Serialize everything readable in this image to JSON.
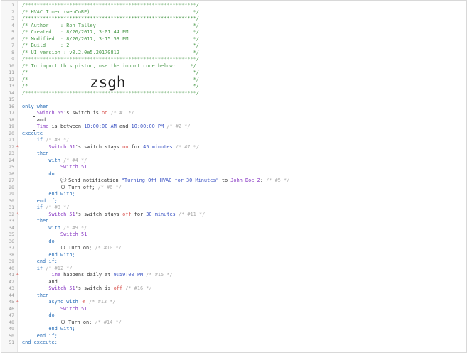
{
  "editor": {
    "lines": [
      {
        "n": "1",
        "parts": [
          {
            "t": "/**********************************************************/",
            "c": "c"
          }
        ]
      },
      {
        "n": "2",
        "parts": [
          {
            "t": "/* HVAC Timer (webCoRE)                                   */",
            "c": "c"
          }
        ]
      },
      {
        "n": "3",
        "parts": [
          {
            "t": "/**********************************************************/",
            "c": "c"
          }
        ]
      },
      {
        "n": "4",
        "parts": [
          {
            "t": "/* Author    : Ron Talley                                 */",
            "c": "c"
          }
        ]
      },
      {
        "n": "5",
        "parts": [
          {
            "t": "/* Created   : 8/26/2017, 3:01:44 PM                      */",
            "c": "c"
          }
        ]
      },
      {
        "n": "6",
        "parts": [
          {
            "t": "/* Modified  : 8/26/2017, 3:15:53 PM                      */",
            "c": "c"
          }
        ]
      },
      {
        "n": "7",
        "parts": [
          {
            "t": "/* Build     : 2                                          */",
            "c": "c"
          }
        ]
      },
      {
        "n": "8",
        "parts": [
          {
            "t": "/* UI version : v0.2.0e5.20170812                         */",
            "c": "c"
          }
        ]
      },
      {
        "n": "9",
        "parts": [
          {
            "t": "/**********************************************************/",
            "c": "c"
          }
        ]
      },
      {
        "n": "10",
        "parts": [
          {
            "t": "/* To import this piston, use the import code below:     */",
            "c": "c"
          }
        ]
      },
      {
        "n": "11",
        "parts": [
          {
            "t": "/*                                                        */",
            "c": "c"
          }
        ]
      },
      {
        "n": "12",
        "parts": [
          {
            "t": "/*                                                        */",
            "c": "c"
          }
        ]
      },
      {
        "n": "13",
        "parts": [
          {
            "t": "/*                                                        */",
            "c": "c"
          }
        ]
      },
      {
        "n": "14",
        "parts": [
          {
            "t": "/**********************************************************/",
            "c": "c"
          }
        ]
      },
      {
        "n": "15",
        "parts": []
      },
      {
        "n": "16",
        "parts": [
          {
            "t": "only when",
            "c": "k"
          }
        ]
      },
      {
        "n": "17",
        "parts": [
          {
            "t": "     ",
            "c": "o"
          },
          {
            "t": "Switch 55",
            "c": "d"
          },
          {
            "t": "'s switch is ",
            "c": "o"
          },
          {
            "t": "on",
            "c": "n"
          },
          {
            "t": " /* #1 */",
            "c": "cm"
          }
        ]
      },
      {
        "n": "18",
        "parts": [
          {
            "t": "     and",
            "c": "o"
          }
        ]
      },
      {
        "n": "19",
        "parts": [
          {
            "t": "     ",
            "c": "o"
          },
          {
            "t": "Time",
            "c": "d"
          },
          {
            "t": " is between ",
            "c": "o"
          },
          {
            "t": "10:00:00 AM",
            "c": "s"
          },
          {
            "t": " and ",
            "c": "o"
          },
          {
            "t": "10:00:00 PM",
            "c": "s"
          },
          {
            "t": " /* #2 */",
            "c": "cm"
          }
        ]
      },
      {
        "n": "20",
        "parts": [
          {
            "t": "execute",
            "c": "k"
          }
        ]
      },
      {
        "n": "21",
        "parts": [
          {
            "t": "     if",
            "c": "k"
          },
          {
            "t": " /* #3 */",
            "c": "cm"
          }
        ]
      },
      {
        "n": "22",
        "mark": "ϟ",
        "parts": [
          {
            "t": "         ",
            "c": "o"
          },
          {
            "t": "Switch 51",
            "c": "d"
          },
          {
            "t": "'s switch stays ",
            "c": "o"
          },
          {
            "t": "on",
            "c": "n"
          },
          {
            "t": " for ",
            "c": "o"
          },
          {
            "t": "45 minutes",
            "c": "s"
          },
          {
            "t": " /* #7 */",
            "c": "cm"
          }
        ]
      },
      {
        "n": "23",
        "parts": [
          {
            "t": "     then",
            "c": "k"
          }
        ]
      },
      {
        "n": "24",
        "parts": [
          {
            "t": "         with",
            "c": "k"
          },
          {
            "t": " /* #4 */",
            "c": "cm"
          }
        ]
      },
      {
        "n": "25",
        "parts": [
          {
            "t": "             ",
            "c": "o"
          },
          {
            "t": "Switch 51",
            "c": "d"
          }
        ]
      },
      {
        "n": "26",
        "parts": [
          {
            "t": "         do",
            "c": "k"
          }
        ]
      },
      {
        "n": "27",
        "icon": "💬",
        "parts": [
          {
            "t": "             ",
            "c": "o"
          },
          {
            "t": "ICON",
            "c": "icon"
          },
          {
            "t": " Send notification ",
            "c": "o"
          },
          {
            "t": "\"Turning Off HVAC for 30 Minutes\"",
            "c": "s"
          },
          {
            "t": " to ",
            "c": "o"
          },
          {
            "t": "John Doe 2",
            "c": "d"
          },
          {
            "t": ";",
            "c": "o"
          },
          {
            "t": " /* #5 */",
            "c": "cm"
          }
        ]
      },
      {
        "n": "28",
        "icon": "⏻",
        "parts": [
          {
            "t": "             ",
            "c": "o"
          },
          {
            "t": "ICON",
            "c": "icon"
          },
          {
            "t": " Turn off;",
            "c": "o"
          },
          {
            "t": " /* #6 */",
            "c": "cm"
          }
        ]
      },
      {
        "n": "29",
        "parts": [
          {
            "t": "         end with;",
            "c": "k"
          }
        ]
      },
      {
        "n": "30",
        "parts": [
          {
            "t": "     end if;",
            "c": "k"
          }
        ]
      },
      {
        "n": "31",
        "parts": [
          {
            "t": "     if",
            "c": "k"
          },
          {
            "t": " /* #8 */",
            "c": "cm"
          }
        ]
      },
      {
        "n": "32",
        "mark": "ϟ",
        "parts": [
          {
            "t": "         ",
            "c": "o"
          },
          {
            "t": "Switch 51",
            "c": "d"
          },
          {
            "t": "'s switch stays ",
            "c": "o"
          },
          {
            "t": "off",
            "c": "n"
          },
          {
            "t": " for ",
            "c": "o"
          },
          {
            "t": "30 minutes",
            "c": "s"
          },
          {
            "t": " /* #11 */",
            "c": "cm"
          }
        ]
      },
      {
        "n": "33",
        "parts": [
          {
            "t": "     then",
            "c": "k"
          }
        ]
      },
      {
        "n": "34",
        "parts": [
          {
            "t": "         with",
            "c": "k"
          },
          {
            "t": " /* #9 */",
            "c": "cm"
          }
        ]
      },
      {
        "n": "35",
        "parts": [
          {
            "t": "             ",
            "c": "o"
          },
          {
            "t": "Switch 51",
            "c": "d"
          }
        ]
      },
      {
        "n": "36",
        "parts": [
          {
            "t": "         do",
            "c": "k"
          }
        ]
      },
      {
        "n": "37",
        "icon": "⏻",
        "parts": [
          {
            "t": "             ",
            "c": "o"
          },
          {
            "t": "ICON",
            "c": "icon"
          },
          {
            "t": " Turn on;",
            "c": "o"
          },
          {
            "t": " /* #10 */",
            "c": "cm"
          }
        ]
      },
      {
        "n": "38",
        "parts": [
          {
            "t": "         end with;",
            "c": "k"
          }
        ]
      },
      {
        "n": "39",
        "parts": [
          {
            "t": "     end if;",
            "c": "k"
          }
        ]
      },
      {
        "n": "40",
        "parts": [
          {
            "t": "     if",
            "c": "k"
          },
          {
            "t": " /* #12 */",
            "c": "cm"
          }
        ]
      },
      {
        "n": "41",
        "mark": "ϟ",
        "parts": [
          {
            "t": "         ",
            "c": "o"
          },
          {
            "t": "Time",
            "c": "d"
          },
          {
            "t": " happens daily at ",
            "c": "o"
          },
          {
            "t": "9:59:00 PM",
            "c": "s"
          },
          {
            "t": " /* #15 */",
            "c": "cm"
          }
        ]
      },
      {
        "n": "42",
        "parts": [
          {
            "t": "         and",
            "c": "o"
          }
        ]
      },
      {
        "n": "43",
        "parts": [
          {
            "t": "         ",
            "c": "o"
          },
          {
            "t": "Switch 51",
            "c": "d"
          },
          {
            "t": "'s switch is ",
            "c": "o"
          },
          {
            "t": "off",
            "c": "n"
          },
          {
            "t": " /* #16 */",
            "c": "cm"
          }
        ]
      },
      {
        "n": "44",
        "parts": [
          {
            "t": "     then",
            "c": "k"
          }
        ]
      },
      {
        "n": "45",
        "mark": "ϟ",
        "icon": "⊗",
        "parts": [
          {
            "t": "         async with ",
            "c": "k"
          },
          {
            "t": "ICON",
            "c": "asyncicon"
          },
          {
            "t": " /* #13 */",
            "c": "cm"
          }
        ]
      },
      {
        "n": "46",
        "parts": [
          {
            "t": "             ",
            "c": "o"
          },
          {
            "t": "Switch 51",
            "c": "d"
          }
        ]
      },
      {
        "n": "47",
        "parts": [
          {
            "t": "         do",
            "c": "k"
          }
        ]
      },
      {
        "n": "48",
        "icon": "⏻",
        "parts": [
          {
            "t": "             ",
            "c": "o"
          },
          {
            "t": "ICON",
            "c": "icon"
          },
          {
            "t": " Turn on;",
            "c": "o"
          },
          {
            "t": " /* #14 */",
            "c": "cm"
          }
        ]
      },
      {
        "n": "49",
        "parts": [
          {
            "t": "         end with;",
            "c": "k"
          }
        ]
      },
      {
        "n": "50",
        "parts": [
          {
            "t": "     end if;",
            "c": "k"
          }
        ]
      },
      {
        "n": "51",
        "parts": [
          {
            "t": "end execute;",
            "c": "k"
          }
        ]
      }
    ],
    "import_code": "zsgh",
    "colors": {
      "comment": "#4d9a4d",
      "keyword": "#2a6fb8",
      "device": "#8a3cc4",
      "value": "#3e56c4",
      "state": "#d9534f",
      "id_comment": "#aaaaaa"
    }
  }
}
